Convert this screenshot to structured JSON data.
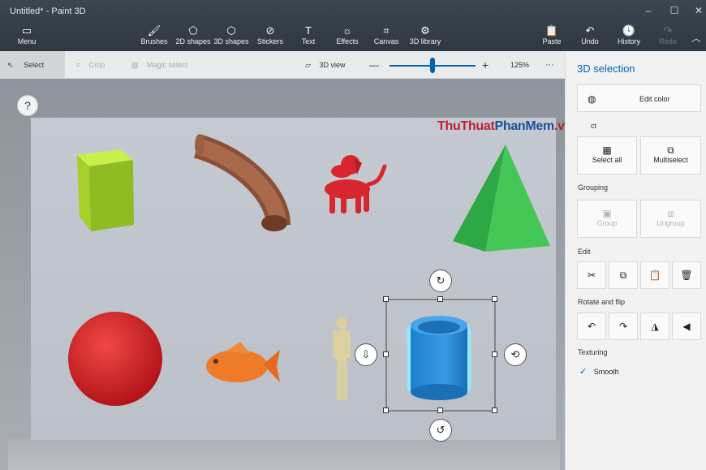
{
  "window": {
    "title": "Untitled* - Paint 3D",
    "controls": [
      "–",
      "☐",
      "✕"
    ]
  },
  "ribbon": {
    "menu": {
      "icon": "menu-icon",
      "label": "Menu"
    },
    "tools": [
      {
        "label": "Brushes",
        "icon": "brush-icon",
        "glyph": "🖌"
      },
      {
        "label": "2D shapes",
        "icon": "2d-shapes-icon",
        "glyph": "⬠"
      },
      {
        "label": "3D shapes",
        "icon": "3d-shapes-icon",
        "glyph": "⬡"
      },
      {
        "label": "Stickers",
        "icon": "stickers-icon",
        "glyph": "⊘"
      },
      {
        "label": "Text",
        "icon": "text-icon",
        "glyph": "T"
      },
      {
        "label": "Effects",
        "icon": "effects-icon",
        "glyph": "☼"
      },
      {
        "label": "Canvas",
        "icon": "canvas-icon",
        "glyph": "⌗"
      },
      {
        "label": "3D library",
        "icon": "3d-library-icon",
        "glyph": "⚙"
      }
    ],
    "right": [
      {
        "label": "Paste",
        "icon": "paste-icon",
        "glyph": "📋"
      },
      {
        "label": "Undo",
        "icon": "undo-icon",
        "glyph": "↶"
      },
      {
        "label": "History",
        "icon": "history-icon",
        "glyph": "🕓"
      },
      {
        "label": "Redo",
        "icon": "redo-icon",
        "glyph": "↷"
      }
    ]
  },
  "toolbar": {
    "select": "Select",
    "crop": "Crop",
    "magic_select": "Magic select",
    "view3d": "3D view",
    "zoom_minus": "—",
    "zoom_plus": "+",
    "zoom_value": "125%",
    "zoom_level_percent": 50,
    "more": "···"
  },
  "help": "?",
  "watermark": {
    "part1": "Thu",
    "part2": "Thuat",
    "part3": "PhanMem",
    "part4": ".vn"
  },
  "panel": {
    "title": "3D selection",
    "edit_color": "Edit color",
    "select_header": "ct",
    "select_all": "Select all",
    "multiselect": "Multiselect",
    "grouping": "Grouping",
    "group": "Group",
    "ungroup": "Ungroup",
    "edit": "Edit",
    "rotate_flip": "Rotate and flip",
    "texturing": "Texturing",
    "smooth": "Smooth",
    "smooth_checked": true
  },
  "colors": {
    "accent": "#0063b1",
    "panel_bg": "#f2f2f2",
    "ribbon_bg": "#343d46"
  }
}
